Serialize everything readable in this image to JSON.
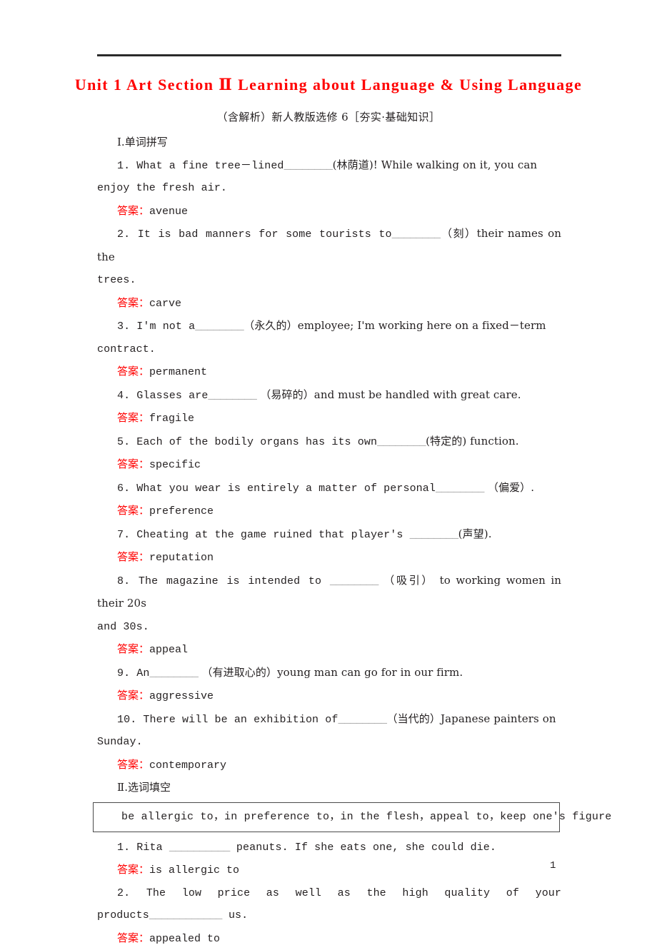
{
  "document": {
    "title": "Unit 1 Art Section Ⅱ Learning about Language & Using Language",
    "subtitle": "（含解析）新人教版选修 6［夯实·基础知识］",
    "page_number": "1",
    "title_color": "#ff0000",
    "answer_label_color": "#ff0000",
    "body_color": "#231f20"
  },
  "sections": [
    {
      "heading": "Ⅰ.单词拼写",
      "answer_label": "答案：",
      "items": [
        {
          "number": "1.",
          "text": "1. What  a  fine  tree－lined________(林荫道)!  While walking on it, you can enjoy the fresh air.",
          "answer": "avenue"
        },
        {
          "number": "2.",
          "text": "2. It is bad manners for some tourists to________（刻）their names on the trees.",
          "answer": "carve"
        },
        {
          "number": "3.",
          "text": "3. I'm not a________（永久的）employee;  I'm working here on a fixed－term contract.",
          "answer": "permanent"
        },
        {
          "number": "4.",
          "text": "4. Glasses are________  （易碎的）and must be handled with great care.",
          "answer": "fragile"
        },
        {
          "number": "5.",
          "text": "5. Each of the bodily organs has its own________(特定的)  function.",
          "answer": "specific"
        },
        {
          "number": "6.",
          "text": "6. What you wear is entirely a matter of personal________ （偏爱）.",
          "answer": "preference"
        },
        {
          "number": "7.",
          "text": "7. Cheating at the game ruined that player's ________(声望).",
          "answer": "reputation"
        },
        {
          "number": "8.",
          "text": "8. The magazine is intended to ________ （吸引） to  working women in their 20s and 30s.",
          "answer": "appeal"
        },
        {
          "number": "9.",
          "text": "9. An________  （有进取心的）young man can go for in our firm.",
          "answer": "aggressive"
        },
        {
          "number": "10.",
          "text": "10. There will be an exhibition of________（当代的）Japanese painters on Sunday.",
          "answer": "contemporary"
        }
      ]
    },
    {
      "heading": "Ⅱ.选词填空",
      "answer_label": "答案：",
      "word_bank": "be allergic to，in preference to，in the flesh，appeal to，keep one's figure",
      "items": [
        {
          "number": "1.",
          "text": "1. Rita __________ peanuts. If she eats one, she could die.",
          "answer": "is allergic to"
        },
        {
          "number": "2.",
          "text": "2. The low price as well as the high quality of your products____________  us.",
          "answer": "appealed to"
        }
      ]
    }
  ],
  "q_parts": {
    "i1a": "1. What  a  fine  tree－lined",
    "i1b": "________",
    "i1c": "(林荫道)!  While walking on it, you can",
    "i1d": "enjoy the fresh air.",
    "i2a": "2. It is bad manners for some tourists to",
    "i2b": "________",
    "i2c": "（刻）their names on the",
    "i2d": "trees.",
    "i3a": "3. I'm not a",
    "i3b": "________",
    "i3c": "（永久的）employee;  I'm working here on a fixed－term",
    "i3d": "contract.",
    "i4a": "4. Glasses are",
    "i4b": "________",
    "i4c": "  （易碎的）and must be handled with great care.",
    "i5a": "5. Each of the bodily organs has its own",
    "i5b": "________",
    "i5c": "(特定的)  function.",
    "i6a": "6. What you wear is entirely a matter of personal",
    "i6b": "________",
    "i6c": " （偏爱）.",
    "i7a": "7. Cheating at the game ruined that player's ",
    "i7b": "________",
    "i7c": "(声望).",
    "i8a": "8. The magazine is intended to ",
    "i8b": "________",
    "i8c": " （吸引） to  working women in their 20s",
    "i8d": "and 30s.",
    "i9a": "9. An",
    "i9b": "________",
    "i9c": "  （有进取心的）young man can go for in our firm.",
    "i10a": "10. There will be an exhibition of",
    "i10b": "________",
    "i10c": "（当代的）Japanese painters on",
    "i10d": "Sunday.",
    "s2q1a": "1. Rita ",
    "s2q1b": "__________",
    "s2q1c": " peanuts. If she eats one, she could die.",
    "s2q2a": "2. The low price as well as the high quality of your products",
    "s2q2b": "____________",
    "s2q2c": "  us."
  },
  "answers": {
    "a1": "avenue",
    "a2": "carve",
    "a3": "permanent",
    "a4": "fragile",
    "a5": "specific",
    "a6": "preference",
    "a7": "reputation",
    "a8": "appeal",
    "a9": "aggressive",
    "a10": "contemporary",
    "b1": "is allergic to",
    "b2": "appealed to"
  },
  "labels": {
    "answer": "答案：",
    "heading1": "Ⅰ.单词拼写",
    "heading2": "Ⅱ.选词填空"
  }
}
